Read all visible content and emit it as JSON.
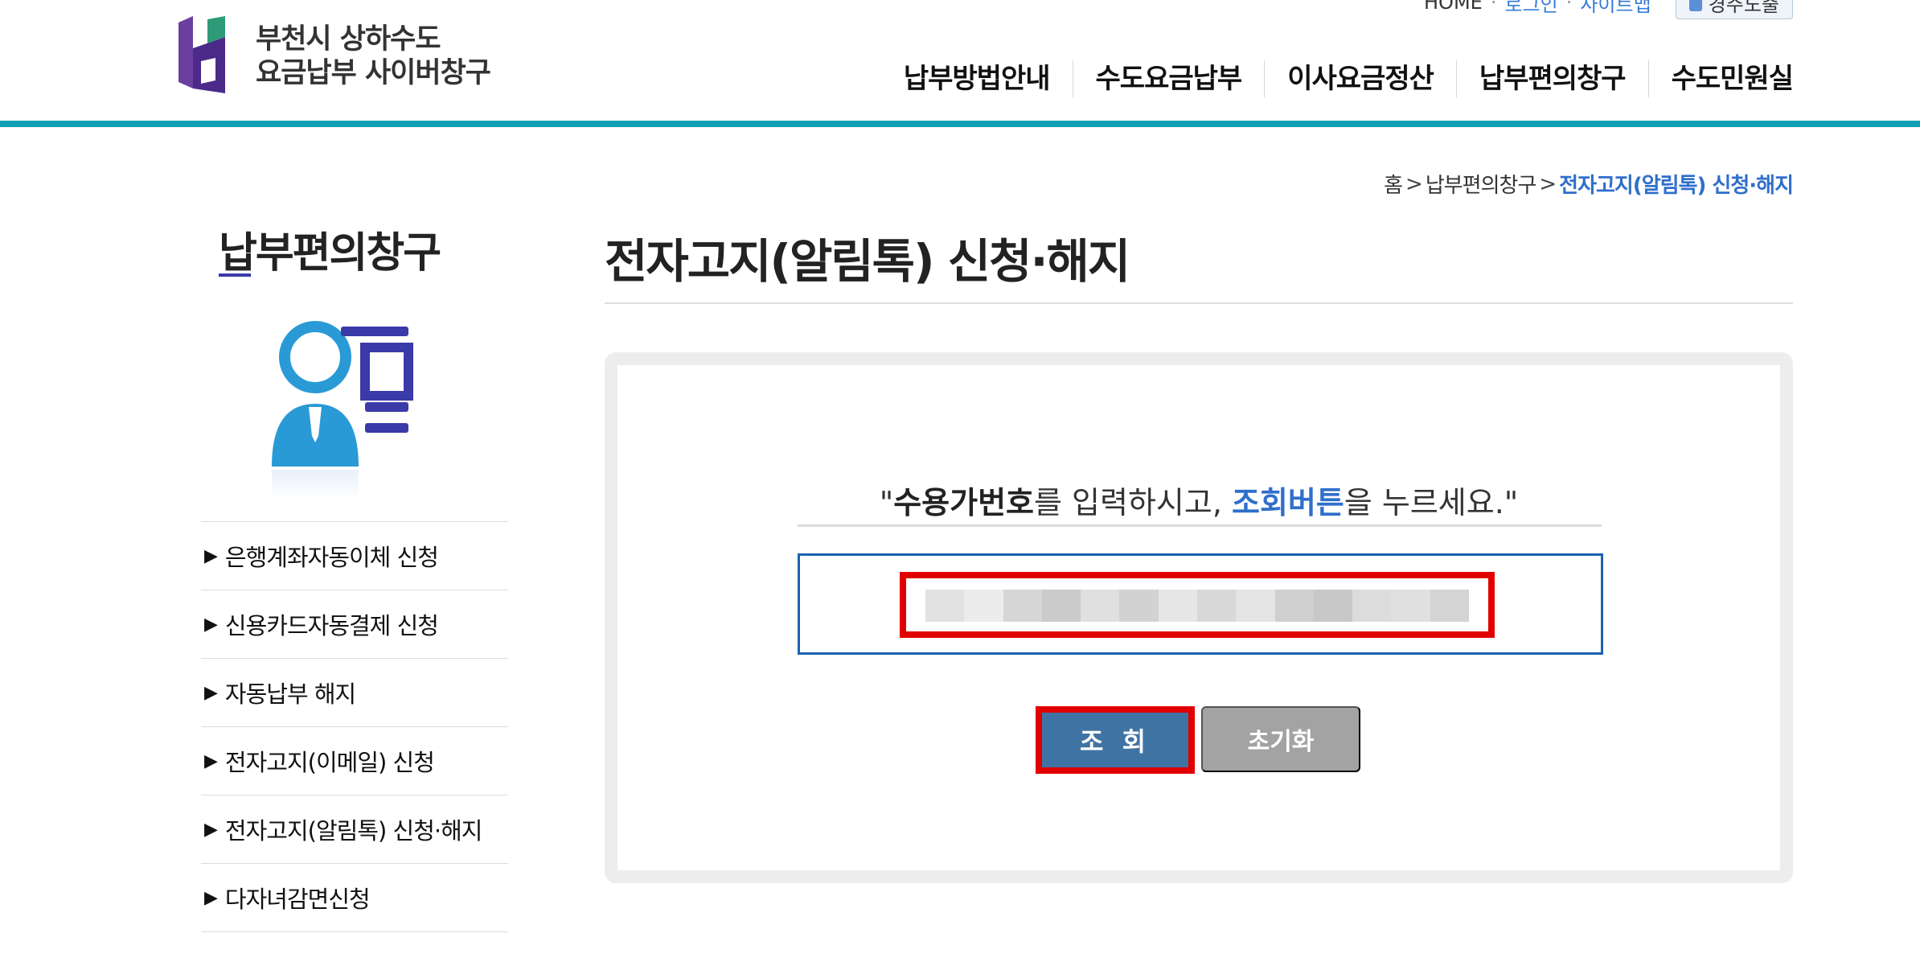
{
  "site": {
    "logo_line1": "부천시 상하수도",
    "logo_line2": "요금납부 사이버창구"
  },
  "topbar": {
    "home": "HOME",
    "login": "로그인",
    "sitemap": "사이트맵",
    "app_button": "경주노출"
  },
  "gnb": [
    {
      "label": "납부방법안내"
    },
    {
      "label": "수도요금납부"
    },
    {
      "label": "이사요금정산"
    },
    {
      "label": "납부편의창구"
    },
    {
      "label": "수도민원실"
    }
  ],
  "breadcrumb": {
    "home": "홈",
    "parent": "납부편의창구",
    "current": "전자고지(알림톡) 신청·해지"
  },
  "sidebar": {
    "title": "납부편의창구",
    "items": [
      {
        "label": "은행계좌자동이체 신청"
      },
      {
        "label": "신용카드자동결제 신청"
      },
      {
        "label": "자동납부 해지"
      },
      {
        "label": "전자고지(이메일) 신청"
      },
      {
        "label": "전자고지(알림톡) 신청·해지"
      },
      {
        "label": "다자녀감면신청"
      }
    ]
  },
  "main": {
    "title": "전자고지(알림톡) 신청·해지",
    "instruction": {
      "open_quote": "\"",
      "bold_term": "수용가번호",
      "mid_text": "를 입력하시고, ",
      "button_term": "조회버튼",
      "end_text": "을 누르세요.\""
    },
    "search_button": "조 회",
    "reset_button": "초기화"
  },
  "colors": {
    "accent_teal": "#0fa0b4",
    "link_blue": "#2f6fcc",
    "button_blue": "#3f73a4",
    "highlight_red": "#e00000"
  }
}
